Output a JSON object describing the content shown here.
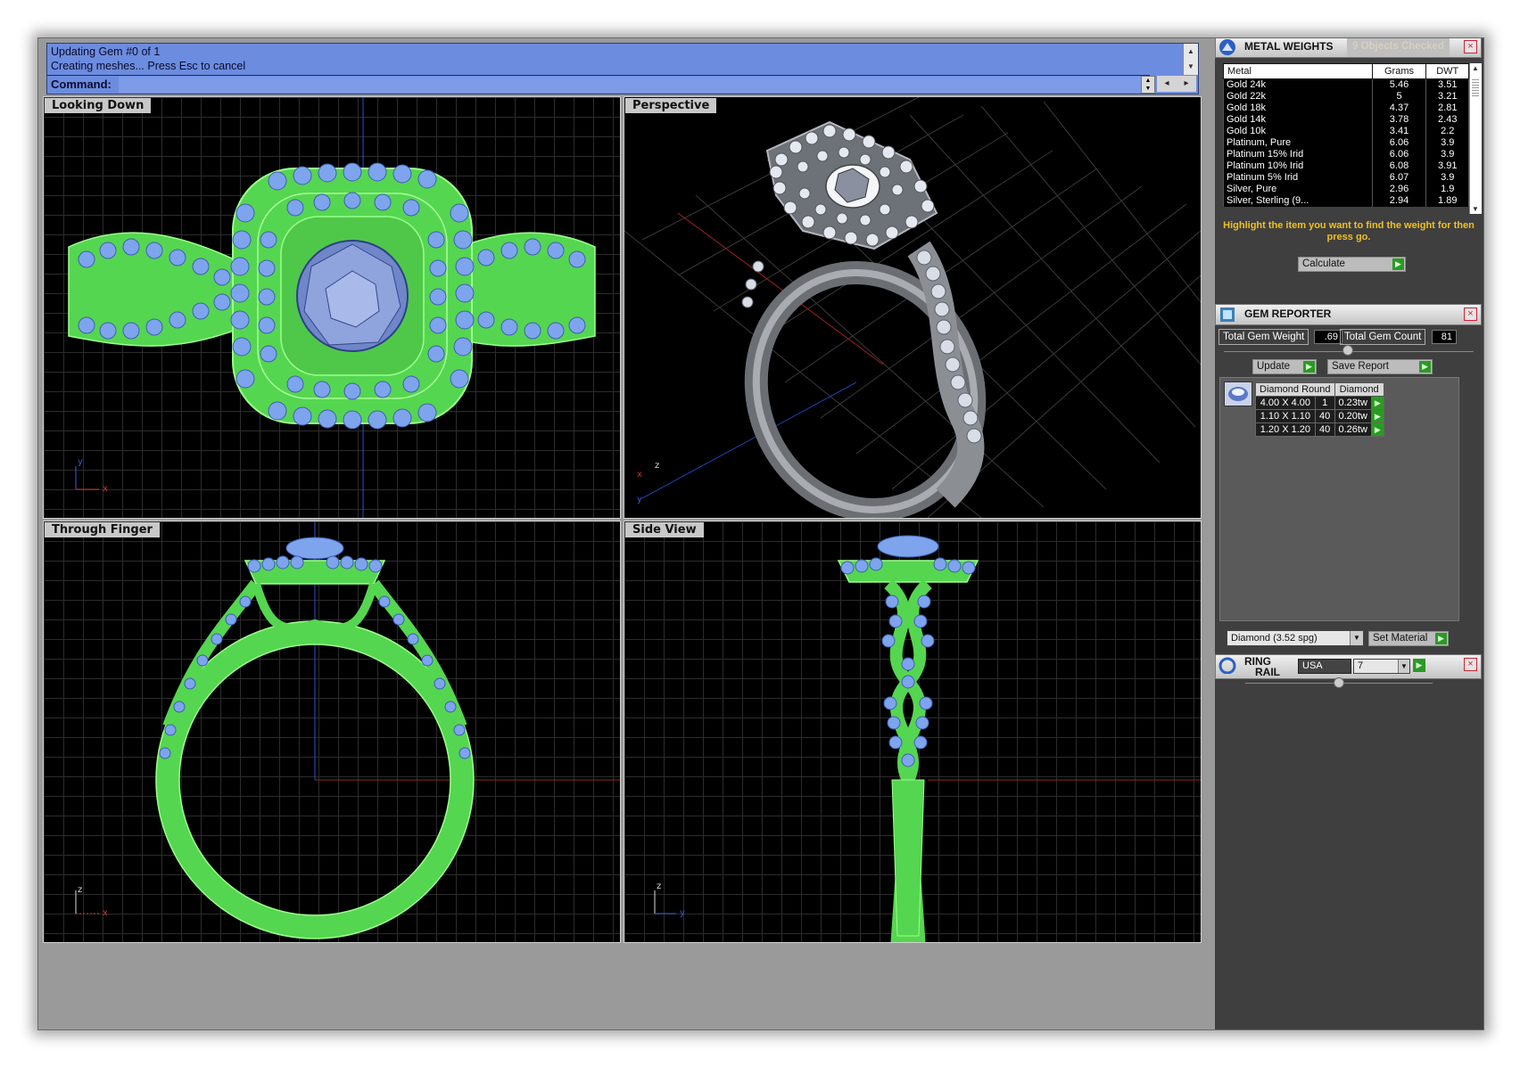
{
  "command": {
    "history": [
      "Updating Gem #0 of 1",
      "Creating meshes... Press Esc to cancel"
    ],
    "label": "Command:",
    "value": ""
  },
  "viewports": {
    "top": {
      "title": "Looking Down",
      "axis1": "y",
      "axis2": "x"
    },
    "perspective": {
      "title": "Perspective",
      "axis1": "z",
      "axis2": "x",
      "axis3": "y"
    },
    "front": {
      "title": "Through Finger",
      "axis1": "z",
      "axis2": "x"
    },
    "side": {
      "title": "Side View",
      "axis1": "z",
      "axis2": "y"
    }
  },
  "metal_weights": {
    "title": "METAL WEIGHTS",
    "status": "9 Objects Checked",
    "columns": [
      "Metal",
      "Grams",
      "DWT"
    ],
    "rows": [
      [
        "Gold 24k",
        "5.46",
        "3.51"
      ],
      [
        "Gold 22k",
        "5",
        "3.21"
      ],
      [
        "Gold 18k",
        "4.37",
        "2.81"
      ],
      [
        "Gold 14k",
        "3.78",
        "2.43"
      ],
      [
        "Gold 10k",
        "3.41",
        "2.2"
      ],
      [
        "Platinum, Pure",
        "6.06",
        "3.9"
      ],
      [
        "Platinum 15% Irid",
        "6.06",
        "3.9"
      ],
      [
        "Platinum 10% Irid",
        "6.08",
        "3.91"
      ],
      [
        "Platinum 5% Irid",
        "6.07",
        "3.9"
      ],
      [
        "Silver, Pure",
        "2.96",
        "1.9"
      ],
      [
        "Silver, Sterling (9...",
        "2.94",
        "1.89"
      ]
    ],
    "hint": "Highlight the item you want to find the weight for then press go.",
    "calculate_label": "Calculate"
  },
  "gem_reporter": {
    "title": "GEM REPORTER",
    "total_weight_label": "Total Gem Weight",
    "total_weight": ".69",
    "total_count_label": "Total Gem Count",
    "total_count": "81",
    "update_label": "Update",
    "save_label": "Save Report",
    "columns": [
      "Diamond Round",
      "",
      "Diamond"
    ],
    "rows": [
      [
        "4.00 X 4.00",
        "1",
        "0.23tw"
      ],
      [
        "1.10 X 1.10",
        "40",
        "0.20tw"
      ],
      [
        "1.20 X 1.20",
        "40",
        "0.26tw"
      ]
    ],
    "material_selected": "Diamond    (3.52 spg)",
    "set_material_label": "Set Material"
  },
  "ring_rail": {
    "title_line1": "RING",
    "title_line2": "RAIL",
    "country": "USA",
    "size": "7"
  },
  "colors": {
    "command_bg": "#6c8cdf",
    "wire_green": "#6ee85a",
    "gem_blue": "#7ea4ee",
    "hint_yellow": "#f0c020",
    "go_green": "#2b9a24"
  }
}
